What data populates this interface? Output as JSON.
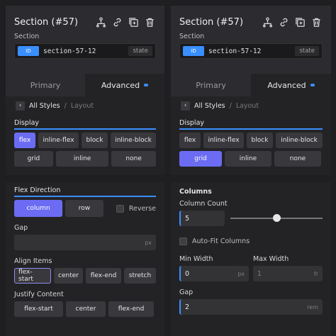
{
  "left": {
    "title": "Section (#57)",
    "section_label": "Section",
    "id_badge": "ID",
    "id_value": "section-57-12",
    "state_label": "state",
    "tabs": {
      "primary": "Primary",
      "advanced": "Advanced"
    },
    "breadcrumb": {
      "active": "All Styles",
      "sep": "/",
      "inactive": "Layout"
    },
    "display": {
      "label": "Display",
      "row1": [
        "flex",
        "inline-flex",
        "block",
        "inline-block"
      ],
      "row2": [
        "grid",
        "inline",
        "none"
      ],
      "selected": "flex"
    },
    "flex_direction": {
      "label": "Flex Direction",
      "column": "column",
      "row": "row",
      "reverse": "Reverse"
    },
    "gap": {
      "label": "Gap",
      "unit": "px"
    },
    "align_items": {
      "label": "Align Items",
      "options": [
        "flex-start",
        "center",
        "flex-end",
        "stretch"
      ]
    },
    "justify_content": {
      "label": "Justify Content",
      "options": [
        "flex-start",
        "center",
        "flex-end"
      ]
    }
  },
  "right": {
    "title": "Section (#57)",
    "section_label": "Section",
    "id_badge": "ID",
    "id_value": "section-57-12",
    "state_label": "state",
    "tabs": {
      "primary": "Primary",
      "advanced": "Advanced"
    },
    "breadcrumb": {
      "active": "All Styles",
      "sep": "/",
      "inactive": "Layout"
    },
    "display": {
      "label": "Display",
      "row1": [
        "flex",
        "inline-flex",
        "block",
        "inline-block"
      ],
      "row2": [
        "grid",
        "inline",
        "none"
      ],
      "selected": "grid"
    },
    "columns": {
      "label": "Columns",
      "count_label": "Column Count",
      "count_value": "5",
      "slider_fraction": 0.5,
      "auto_fit": "Auto-Fit Columns",
      "min_width_label": "Min Width",
      "min_width_value": "0",
      "min_width_unit": "px",
      "max_width_label": "Max Width",
      "max_width_value": "1",
      "max_width_unit": "fr",
      "gap_label": "Gap",
      "gap_value": "2",
      "gap_unit": "rem"
    }
  },
  "colors": {
    "accent": "#3a8fff",
    "selected": "#6b6cf3"
  }
}
